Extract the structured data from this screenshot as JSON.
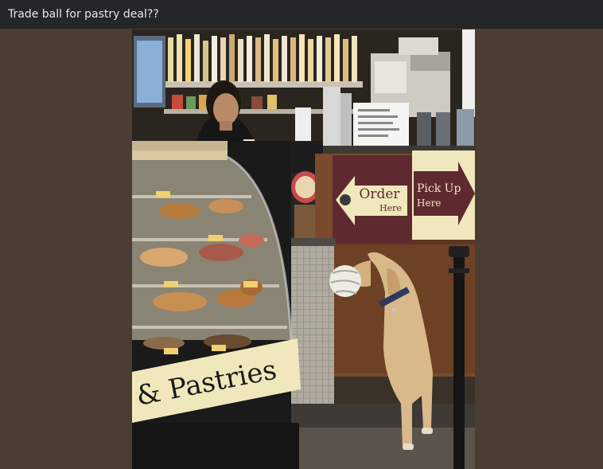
{
  "window": {
    "title": "Trade ball for pastry deal??"
  },
  "photo": {
    "signs": {
      "order": "Order",
      "order_sub": "Here",
      "pickup": "Pick Up",
      "pickup_sub": "Here",
      "case_label": "& Pastries"
    }
  }
}
